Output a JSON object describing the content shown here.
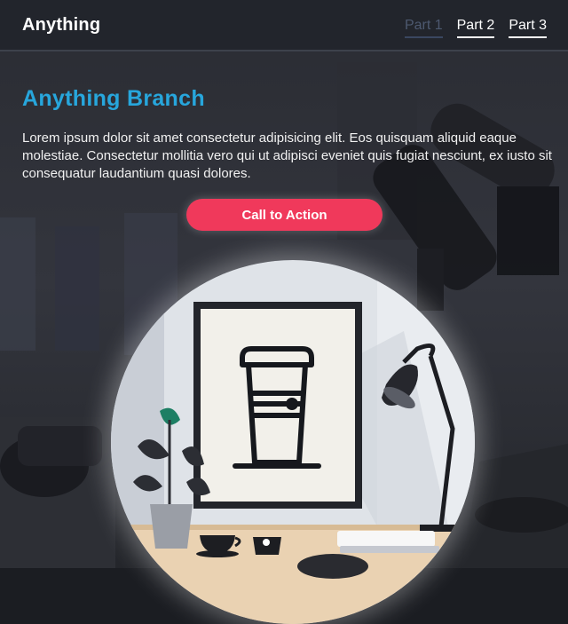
{
  "header": {
    "brand": "Anything",
    "nav": [
      {
        "label": "Part 1",
        "active": true
      },
      {
        "label": "Part 2",
        "active": false
      },
      {
        "label": "Part 3",
        "active": false
      }
    ]
  },
  "hero": {
    "title": "Anything Branch",
    "body": "Lorem ipsum dolor sit amet consectetur adipisicing elit. Eos quisquam aliquid eaque molestiae. Consectetur mollitia vero qui ut adipisci eveniet quis fugiat nesciunt, ex iusto sit consequatur laudantium quasi dolores.",
    "cta_label": "Call to Action"
  },
  "colors": {
    "title_accent": "#27a6dc",
    "cta_background": "#f0395b",
    "nav_active": "#4d5970",
    "topbar": "#22252c"
  },
  "illustration": {
    "subject": "desk with framed coffee cup poster, potted plant, desk lamp and cups"
  }
}
